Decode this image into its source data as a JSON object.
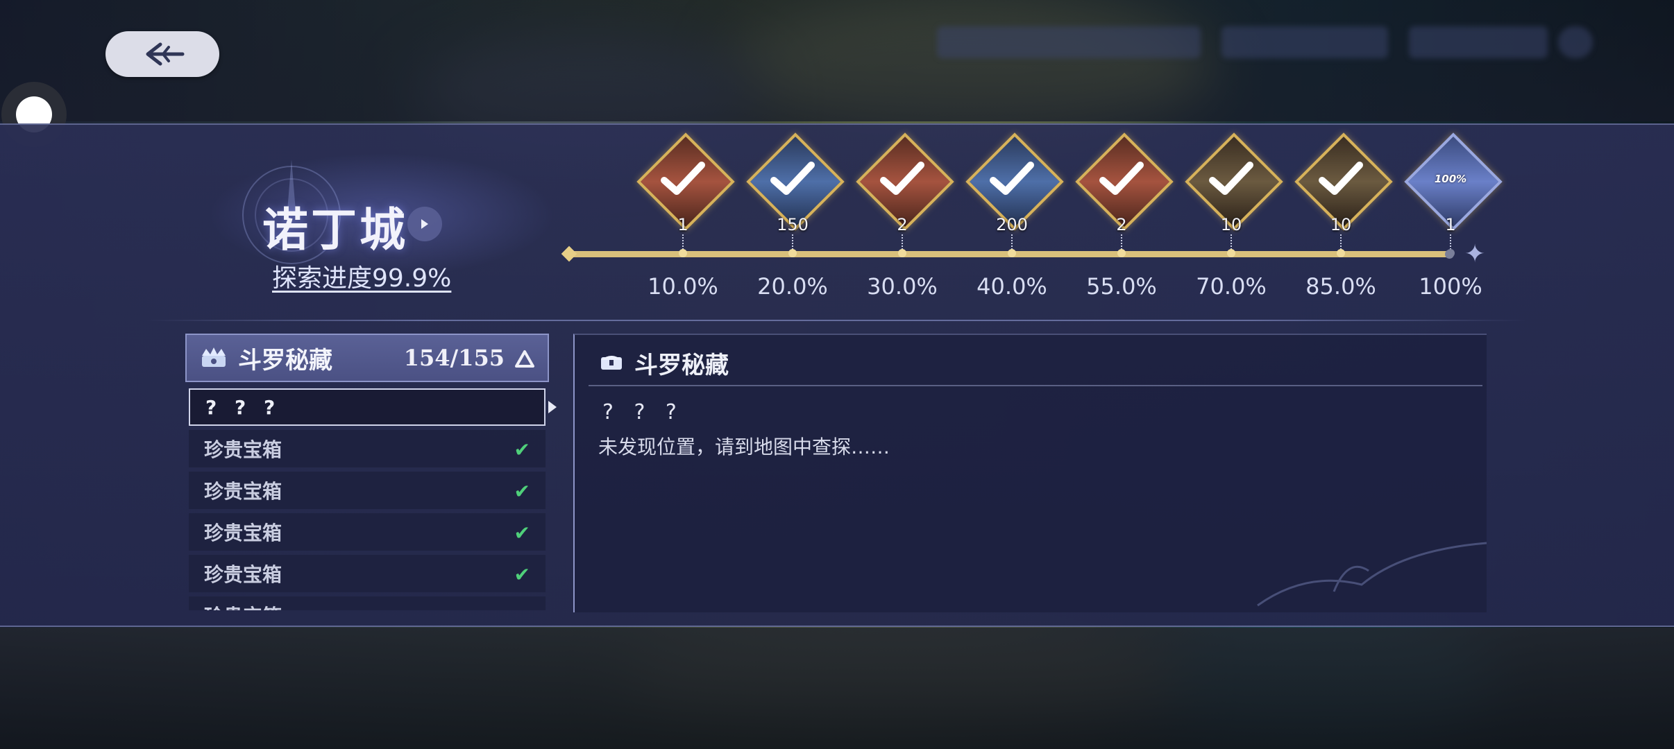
{
  "header": {
    "back_icon": "back-arrow-icon"
  },
  "city": {
    "name": "诺丁城",
    "progress_label": "探索进度99.9%"
  },
  "milestones": [
    {
      "count": "1",
      "percent": "10.0%",
      "style": "red",
      "done": true
    },
    {
      "count": "150",
      "percent": "20.0%",
      "style": "blue",
      "done": true
    },
    {
      "count": "2",
      "percent": "30.0%",
      "style": "red",
      "done": true
    },
    {
      "count": "200",
      "percent": "40.0%",
      "style": "blue",
      "done": true
    },
    {
      "count": "2",
      "percent": "55.0%",
      "style": "red",
      "done": true
    },
    {
      "count": "10",
      "percent": "70.0%",
      "style": "dark",
      "done": true
    },
    {
      "count": "10",
      "percent": "85.0%",
      "style": "dark",
      "done": true
    },
    {
      "count": "1",
      "percent": "100%",
      "style": "final",
      "done": false,
      "badge_text": "100%"
    }
  ],
  "list": {
    "title": "斗罗秘藏",
    "count": "154/155",
    "items": [
      {
        "label": "? ? ?",
        "done": false,
        "selected": true
      },
      {
        "label": "珍贵宝箱",
        "done": true
      },
      {
        "label": "珍贵宝箱",
        "done": true
      },
      {
        "label": "珍贵宝箱",
        "done": true
      },
      {
        "label": "珍贵宝箱",
        "done": true
      },
      {
        "label": "珍贵宝箱",
        "done": true
      }
    ]
  },
  "detail": {
    "title": "斗罗秘藏",
    "name": "? ? ?",
    "description": "未发现位置，请到地图中查探……"
  },
  "colors": {
    "accent_gold": "#d7b25a",
    "check_green": "#4fd07a",
    "panel": "#2a2e54"
  }
}
